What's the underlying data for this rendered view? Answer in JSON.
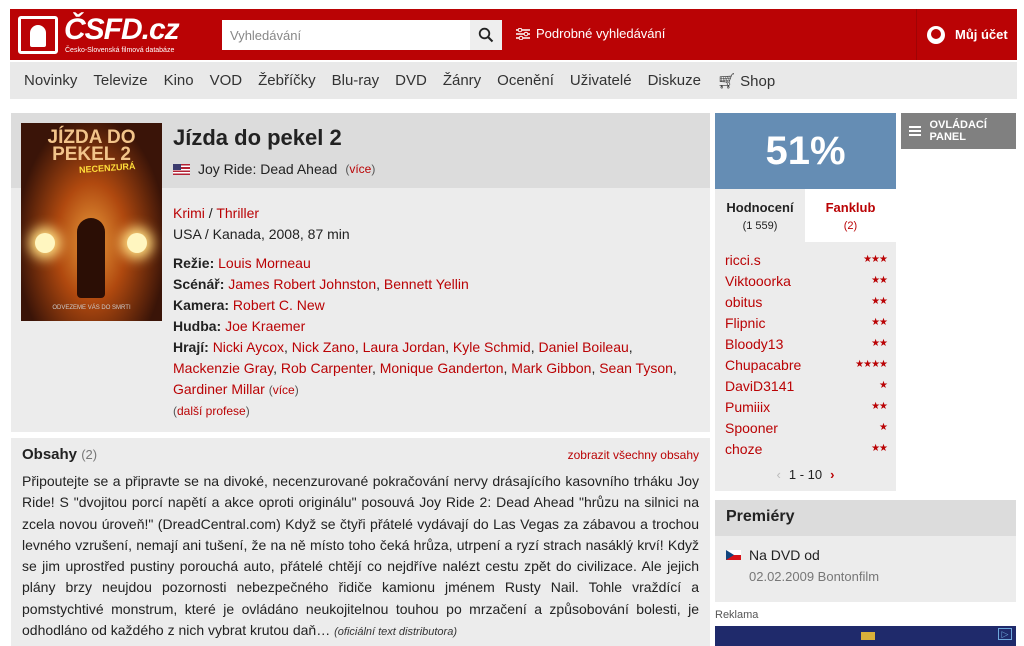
{
  "header": {
    "logo_title": "ČSFD.cz",
    "logo_sub": "Česko-Slovenská filmová databáze",
    "search_placeholder": "Vyhledávání",
    "adv_search": "Podrobné vyhledávání",
    "account": "Můj účet"
  },
  "nav": [
    "Novinky",
    "Televize",
    "Kino",
    "VOD",
    "Žebříčky",
    "Blu-ray",
    "DVD",
    "Žánry",
    "Ocenění",
    "Uživatelé",
    "Diskuze",
    "Shop"
  ],
  "film": {
    "title": "Jízda do pekel 2",
    "original_title": "Joy Ride: Dead Ahead",
    "more": "více",
    "genres": [
      "Krimi",
      "Thriller"
    ],
    "origin": "USA / Kanada, 2008, 87 min",
    "rezie_label": "Režie:",
    "rezie": [
      "Louis Morneau"
    ],
    "scenar_label": "Scénář:",
    "scenar": [
      "James Robert Johnston",
      "Bennett Yellin"
    ],
    "kamera_label": "Kamera:",
    "kamera": [
      "Robert C. New"
    ],
    "hudba_label": "Hudba:",
    "hudba": [
      "Joe Kraemer"
    ],
    "hraji_label": "Hrají:",
    "hraji": [
      "Nicki Aycox",
      "Nick Zano",
      "Laura Jordan",
      "Kyle Schmid",
      "Daniel Boileau",
      "Mackenzie Gray",
      "Rob Carpenter",
      "Monique Ganderton",
      "Mark Gibbon",
      "Sean Tyson",
      "Gardiner Millar"
    ],
    "more_people": "více",
    "other_professions": "další profese",
    "poster": {
      "title": "JÍZDA DO PEKEL 2",
      "badge": "NECENZURÁ",
      "tagline": "ODVEZEME VÁS DO SMRTI"
    }
  },
  "plots": {
    "heading": "Obsahy",
    "count": "(2)",
    "show_all": "zobrazit všechny obsahy",
    "text": "Připoutejte se a připravte se na divoké, necenzurované pokračování nervy drásajícího kasovního trháku Joy Ride! S \"dvojitou porcí napětí a akce oproti originálu\" posouvá Joy Ride 2: Dead Ahead \"hrůzu na silnici na zcela novou úroveň!\" (DreadCentral.com) Když se čtyři přátelé vydávají do Las Vegas za zábavou a trochou levného vzrušení, nemají ani tušení, že na ně místo toho čeká hrůza, utrpení a ryzí strach nasáklý krví! Když se jim uprostřed pustiny porouchá auto, přátelé chtějí co nejdříve nalézt cestu zpět do civilizace. Ale jejich plány brzy neujdou pozornosti nebezpečného řidiče kamionu jménem Rusty Nail. Tohle vraždící a pomstychtivé monstrum, které je ovládáno neukojitelnou touhou po mrzačení a způsobování bolesti, je odhodláno od každého z nich vybrat krutou daň…",
    "source": "(oficiální text distributora)"
  },
  "rating": {
    "score": "51%",
    "tab_ratings": "Hodnocení",
    "tab_ratings_count": "(1 559)",
    "tab_fanclub": "Fanklub",
    "tab_fanclub_count": "(2)",
    "users": [
      {
        "name": "ricci.s",
        "stars": 3
      },
      {
        "name": "Viktooorka",
        "stars": 2
      },
      {
        "name": "obitus",
        "stars": 2
      },
      {
        "name": "Flipnic",
        "stars": 2
      },
      {
        "name": "Bloody13",
        "stars": 2
      },
      {
        "name": "Chupacabre",
        "stars": 4
      },
      {
        "name": "DaviD3141",
        "stars": 1
      },
      {
        "name": "Pumiiix",
        "stars": 2
      },
      {
        "name": "Spooner",
        "stars": 1
      },
      {
        "name": "choze",
        "stars": 2
      }
    ],
    "pager": "1 - 10"
  },
  "control_panel": "OVLÁDACÍ PANEL",
  "premieres": {
    "heading": "Premiéry",
    "item": "Na DVD od",
    "date": "02.02.2009 Bontonfilm"
  },
  "ad_label": "Reklama"
}
